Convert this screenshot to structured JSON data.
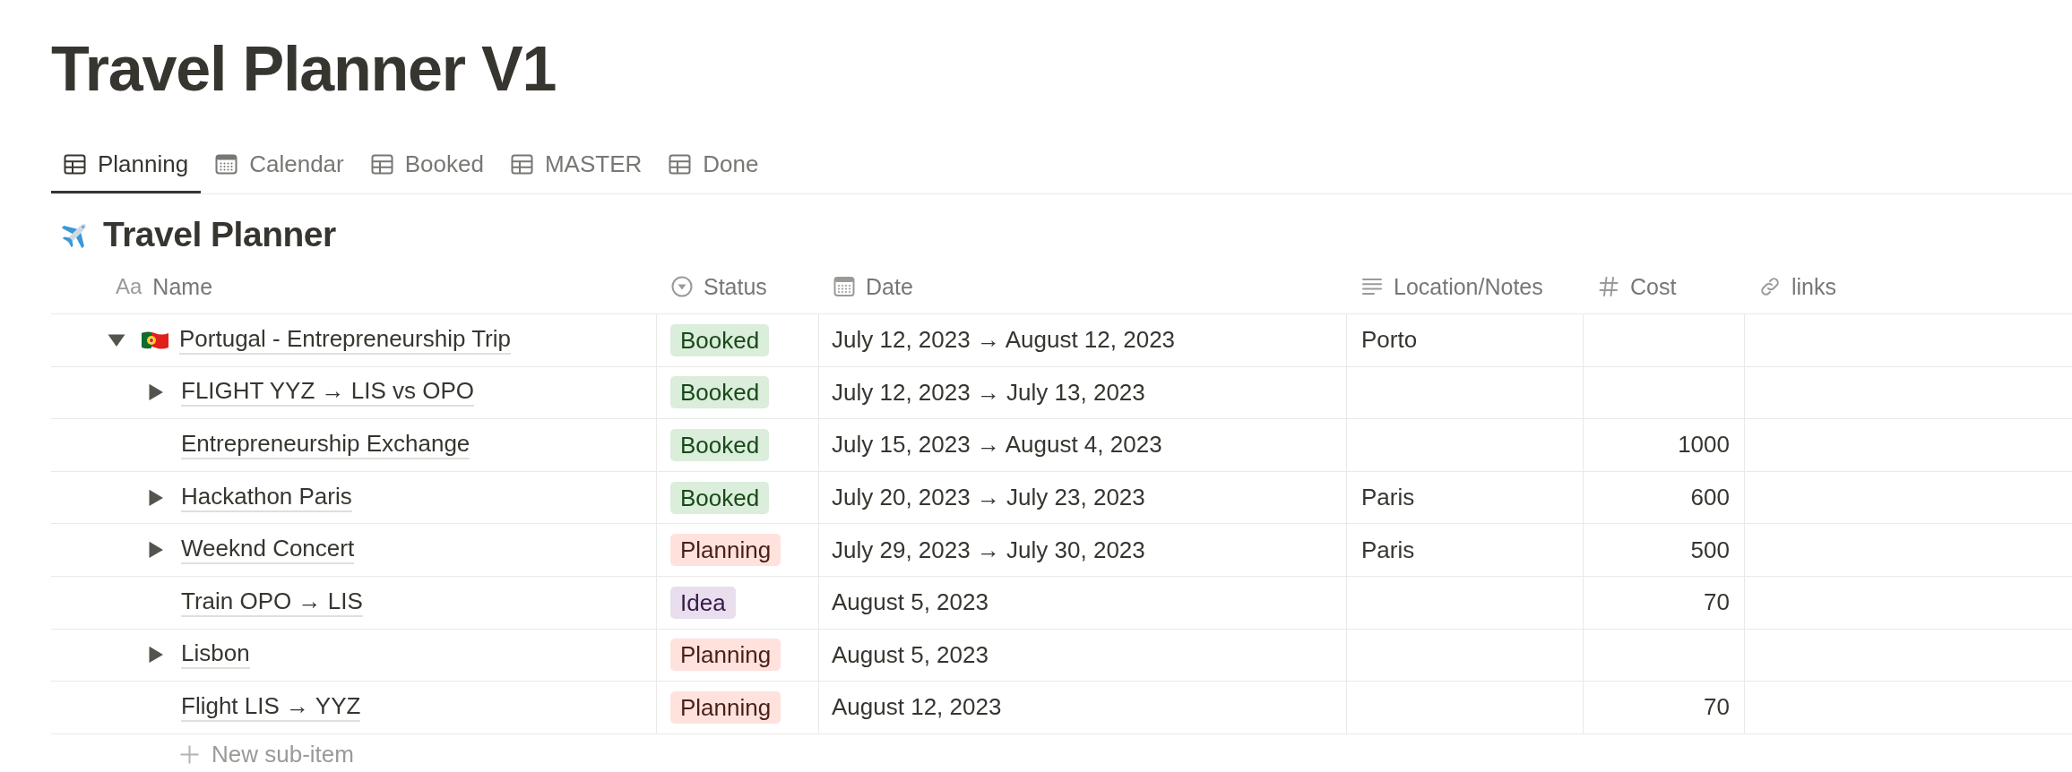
{
  "page": {
    "title": "Travel Planner V1"
  },
  "tabs": [
    {
      "label": "Planning",
      "kind": "table",
      "selected": true
    },
    {
      "label": "Calendar",
      "kind": "calendar",
      "selected": false
    },
    {
      "label": "Booked",
      "kind": "table",
      "selected": false
    },
    {
      "label": "MASTER",
      "kind": "table",
      "selected": false
    },
    {
      "label": "Done",
      "kind": "table",
      "selected": false
    }
  ],
  "database": {
    "title": "Travel Planner"
  },
  "table": {
    "columns": [
      {
        "label": "Name",
        "kind": "title",
        "icon_text": "Aa"
      },
      {
        "label": "Status",
        "kind": "status"
      },
      {
        "label": "Date",
        "kind": "date"
      },
      {
        "label": "Location/Notes",
        "kind": "text"
      },
      {
        "label": "Cost",
        "kind": "number"
      },
      {
        "label": "links",
        "kind": "url"
      }
    ],
    "rows": [
      {
        "name": "Portugal - Entrepreneurship Trip",
        "expanded": true,
        "status": {
          "label": "Booked",
          "color": "#dbeddb"
        },
        "date": "July 12, 2023 → August 12, 2023",
        "location": "Porto",
        "children": [
          {
            "name": "FLIGHT YYZ → LIS vs OPO",
            "expanded": false,
            "status": {
              "label": "Booked",
              "color": "#dbeddb"
            },
            "date": "July 12, 2023 → July 13, 2023"
          },
          {
            "name": "Entrepreneurship Exchange",
            "status": {
              "label": "Booked",
              "color": "#dbeddb"
            },
            "date": "July 15, 2023 → August 4, 2023",
            "cost": "1000"
          },
          {
            "name": "Hackathon Paris",
            "expanded": false,
            "status": {
              "label": "Booked",
              "color": "#dbeddb"
            },
            "date": "July 20, 2023 → July 23, 2023",
            "location": "Paris",
            "cost": "600"
          },
          {
            "name": "Weeknd Concert",
            "expanded": false,
            "status": {
              "label": "Planning",
              "color": "#ffe2dd"
            },
            "date": "July 29, 2023 → July 30, 2023",
            "location": "Paris",
            "cost": "500"
          },
          {
            "name": "Train OPO → LIS",
            "status": {
              "label": "Idea",
              "color": "#e8deee"
            },
            "date": "August 5, 2023",
            "cost": "70"
          },
          {
            "name": "Lisbon",
            "expanded": false,
            "status": {
              "label": "Planning",
              "color": "#ffe2dd"
            },
            "date": "August 5, 2023"
          },
          {
            "name": "Flight LIS → YYZ",
            "status": {
              "label": "Planning",
              "color": "#ffe2dd"
            },
            "date": "August 12, 2023",
            "cost": "70"
          }
        ]
      }
    ],
    "new_sub_item": "New sub-item"
  }
}
